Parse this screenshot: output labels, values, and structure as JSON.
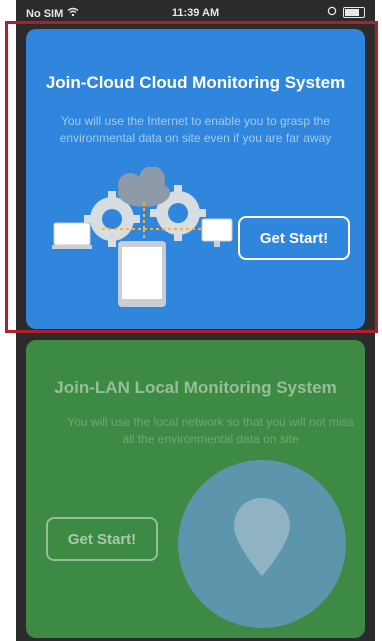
{
  "status_bar": {
    "carrier": "No SIM",
    "time": "11:39 AM"
  },
  "cloud_card": {
    "title": "Join-Cloud Cloud Monitoring System",
    "description": "You will use the Internet to enable you to grasp the environmental data on site even if you are far away",
    "button_label": "Get Start!",
    "background_color": "#2f86dc"
  },
  "lan_card": {
    "title": "Join-LAN Local Monitoring System",
    "description": "You will use the local network so that you will not miss all the environmental data on site",
    "button_label": "Get Start!",
    "background_color": "#3d8a44"
  },
  "icons": [
    "wifi-icon",
    "battery-icon",
    "cloud-network-illustration",
    "location-pin-icon"
  ],
  "highlight_color": "#b0202a"
}
